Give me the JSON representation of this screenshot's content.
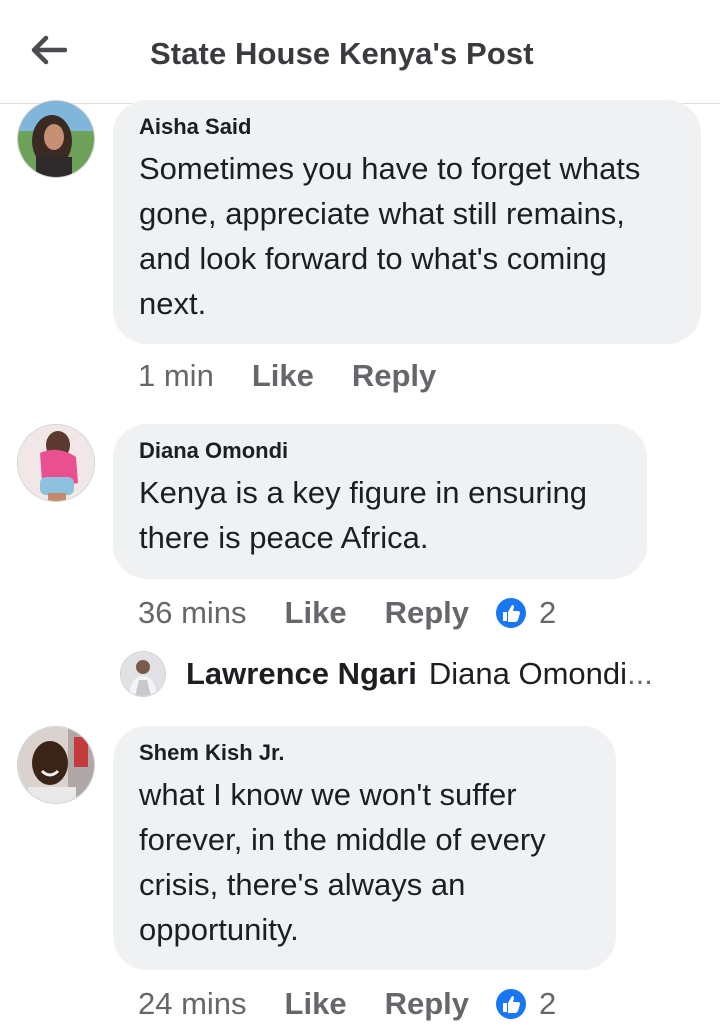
{
  "header": {
    "title": "State House Kenya's Post",
    "back_icon": "arrow-left-icon"
  },
  "comments": [
    {
      "author": "Aisha Said",
      "text": "Sometimes you have to forget whats gone, appreciate what still remains, and look forward to what's coming next.",
      "time": "1 min",
      "like": "Like",
      "reply": "Reply"
    },
    {
      "author": "Diana Omondi",
      "text": "Kenya is a key figure in ensuring there is peace Africa.",
      "time": "36 mins",
      "like": "Like",
      "reply": "Reply",
      "reactions": "2",
      "reply_preview": {
        "author": "Lawrence Ngari",
        "text": "Diana Omondi",
        "ellipsis": "..."
      }
    },
    {
      "author": "Shem Kish Jr.",
      "text": "what I know we won't suffer forever,  in the middle of every crisis, there's always an opportunity.",
      "time": "24 mins",
      "like": "Like",
      "reply": "Reply",
      "reactions": "2"
    }
  ],
  "colors": {
    "like_blue": "#1877f2",
    "bubble": "#eff1f3",
    "meta": "#65676b"
  }
}
